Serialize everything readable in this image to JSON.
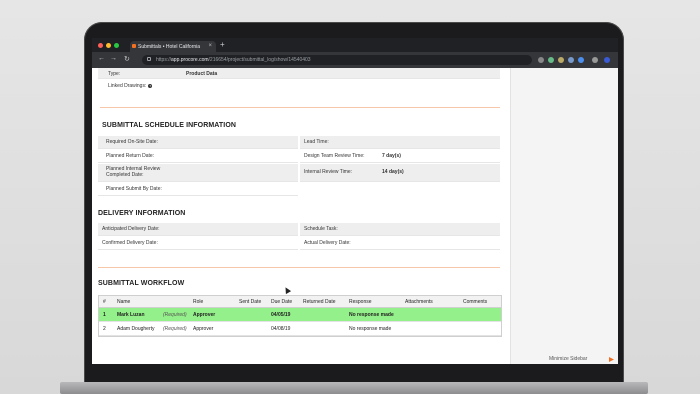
{
  "browser": {
    "tab_title": "Submittals • Hotel California",
    "tab_close": "×",
    "new_tab": "+",
    "url_scheme": "https://",
    "url_host": "app.procore.com",
    "url_path": "/216654/project/submittal_log/show/14540403",
    "nav": {
      "back": "←",
      "forward": "→",
      "reload": "↻"
    }
  },
  "details": {
    "type_label": "Type:",
    "type_value": "Product Data",
    "linked_label": "Linked Drawings:",
    "help": "?"
  },
  "schedule": {
    "title": "SUBMITTAL SCHEDULE INFORMATION",
    "required_onsite": "Required On-Site Date:",
    "lead_time": "Lead Time:",
    "planned_return": "Planned Return Date:",
    "design_review": "Design Team Review Time:",
    "design_review_val": "7 day(s)",
    "planned_internal_1": "Planned Internal Review",
    "planned_internal_2": "Completed Date:",
    "internal_review": "Internal Review Time:",
    "internal_review_val": "14 day(s)",
    "planned_submit": "Planned Submit By Date:"
  },
  "delivery": {
    "title": "DELIVERY INFORMATION",
    "anticipated": "Anticipated Delivery Date:",
    "schedule_task": "Schedule Task:",
    "confirmed": "Confirmed Delivery Date:",
    "actual": "Actual Delivery Date:"
  },
  "workflow": {
    "title": "SUBMITTAL WORKFLOW",
    "columns": [
      "#",
      "Name",
      "Role",
      "Sent Date",
      "Due Date",
      "Returned Date",
      "Response",
      "Attachments",
      "Comments"
    ],
    "rows": [
      {
        "num": "1",
        "name": "Mark Luzan",
        "req": "(Required)",
        "role": "Approver",
        "due": "04/05/19",
        "response": "No response made"
      },
      {
        "num": "2",
        "name": "Adam Dougherty",
        "req": "(Required)",
        "role": "Approver",
        "due": "04/08/19",
        "response": "No response made"
      }
    ]
  },
  "sidebar": {
    "minimize": "Minimize Sidebar"
  },
  "colors": {
    "accent": "#f37021",
    "active_row": "#94f08a"
  }
}
